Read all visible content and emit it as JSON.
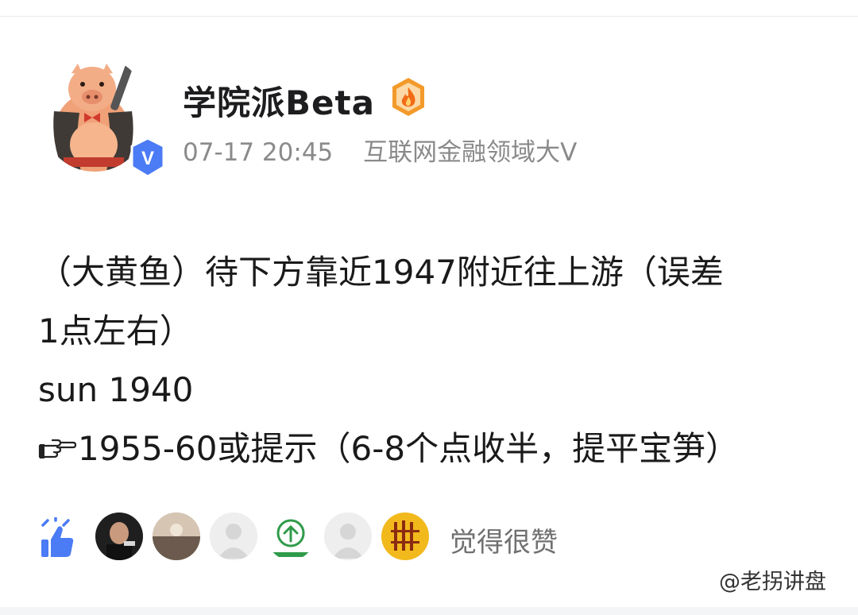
{
  "post": {
    "author": "学院派Beta",
    "time": "07-17 20:45",
    "certification": "互联网金融领域大V",
    "lines": [
      "（大黄鱼）待下方靠近1947附近往上游（误差",
      "1点左右）",
      "sun 1940",
      "1955-60或提示（6-8个点收半，提平宝笋）"
    ]
  },
  "likes": {
    "label": "觉得很赞",
    "avatar_count": 6
  },
  "watermark": "@老拐讲盘",
  "colors": {
    "accent_blue": "#4b7bf5",
    "level_orange": "#f39a2b",
    "meta_gray": "#8a8a8a"
  },
  "icons": {
    "verified": "verified-v-badge-icon",
    "level": "flame-level-badge-icon",
    "pointing": "pointing-hand-icon",
    "thumb": "thumbs-up-icon"
  }
}
